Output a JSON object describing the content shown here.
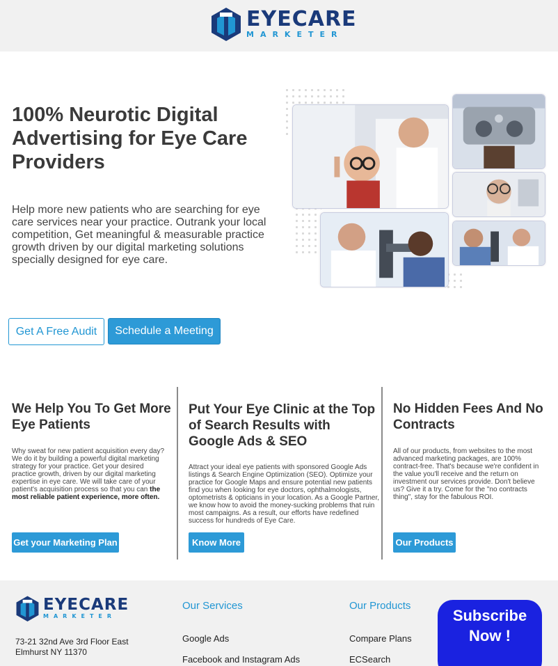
{
  "brand": {
    "word1": "EYECARE",
    "word2": "MARKETER",
    "colors": {
      "navy": "#1a3a7a",
      "blue": "#2196d3"
    }
  },
  "hero": {
    "title": "100% Neurotic Digital Advertising for Eye Care Providers",
    "description": "Help more new patients who are searching for eye care services near your practice. Outrank your local competition, Get meaningful & measurable practice growth driven by our digital marketing solutions specially designed for eye care.",
    "buttons": {
      "audit": "Get A Free Audit",
      "meeting": "Schedule a Meeting"
    }
  },
  "columns": [
    {
      "title": "We Help You To Get More Eye Patients",
      "text": "Why sweat for new patient acquisition every day? We do it by building a powerful digital marketing strategy for your practice. Get your desired practice growth, driven by our digital marketing expertise in eye care. We will take care of your patient's acquisition process so that you can",
      "text_bold": "the most reliable patient experience, more often.",
      "button": "Get your Marketing Plan"
    },
    {
      "title": "Put Your Eye Clinic at the Top of Search Results with Google Ads & SEO",
      "text": "Attract your ideal eye patients with sponsored Google Ads listings & Search Engine Optimization (SEO). Optimize your practice for Google Maps and ensure potential new patients find you when looking for eye doctors, ophthalmologists, optometrists & opticians in your location. As a Google Partner, we know how to avoid the money-sucking problems that ruin most campaigns. As a result, our efforts have redefined success for hundreds of Eye Care.",
      "button": "Know More"
    },
    {
      "title": "No Hidden Fees And No Contracts",
      "text": "All of our products, from websites to the most advanced marketing packages, are 100% contract-free. That's because we're confident in the value you'll receive and the return on investment our services provide. Don't believe us? Give it a try. Come for the \"no contracts thing\", stay for the fabulous ROI.",
      "button": "Our Products"
    }
  ],
  "footer": {
    "address_line1": "73-21 32nd Ave 3rd Floor East",
    "address_line2": "Elmhurst NY 11370",
    "services_heading": "Our Services",
    "services": [
      "Google Ads",
      "Facebook and Instagram Ads"
    ],
    "products_heading": "Our Products",
    "products": [
      "Compare Plans",
      "ECSearch"
    ],
    "subscribe": "Subscribe Now !"
  }
}
